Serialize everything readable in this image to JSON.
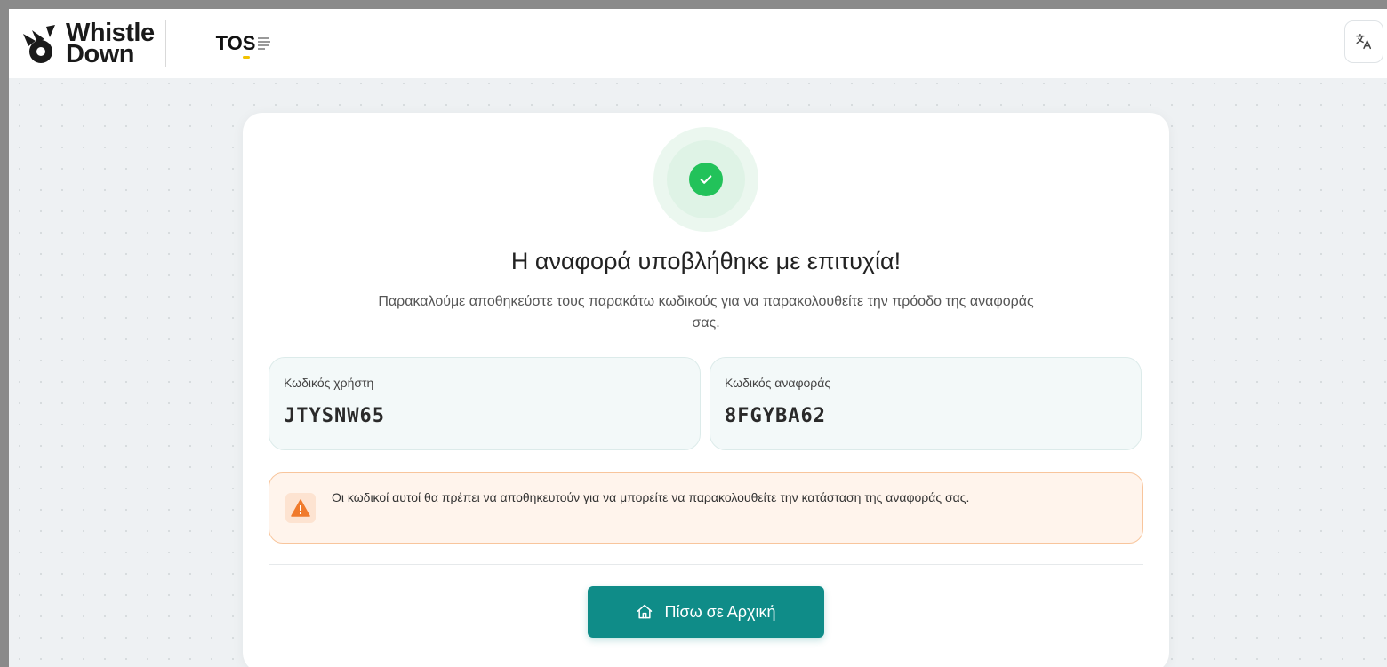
{
  "header": {
    "logo": {
      "line1": "Whistle",
      "line2": "Down"
    },
    "partner_logo": {
      "text": "TOS"
    },
    "language_icon": "translate-icon"
  },
  "success": {
    "icon": "check-circle-icon",
    "title": "Η αναφορά υποβλήθηκε με επιτυχία!",
    "subtitle": "Παρακαλούμε αποθηκεύστε τους παρακάτω κωδικούς για να παρακολουθείτε την πρόοδο της αναφοράς σας."
  },
  "codes": {
    "user": {
      "label": "Κωδικός χρήστη",
      "value": "JTYSNW65"
    },
    "report": {
      "label": "Κωδικός αναφοράς",
      "value": "8FGYBA62"
    }
  },
  "warning": {
    "icon": "warning-triangle-icon",
    "text": "Οι κωδικοί αυτοί θα πρέπει να αποθηκευτούν για να μπορείτε να παρακολουθείτε την κατάσταση της αναφοράς σας."
  },
  "actions": {
    "home_label": "Πίσω σε Αρχική",
    "home_icon": "home-icon"
  },
  "colors": {
    "primary": "#0f8c88",
    "success": "#22c25a",
    "warning_border": "#f8c59c",
    "warning_bg": "#fff4ec",
    "warning_icon": "#f07a2c"
  }
}
